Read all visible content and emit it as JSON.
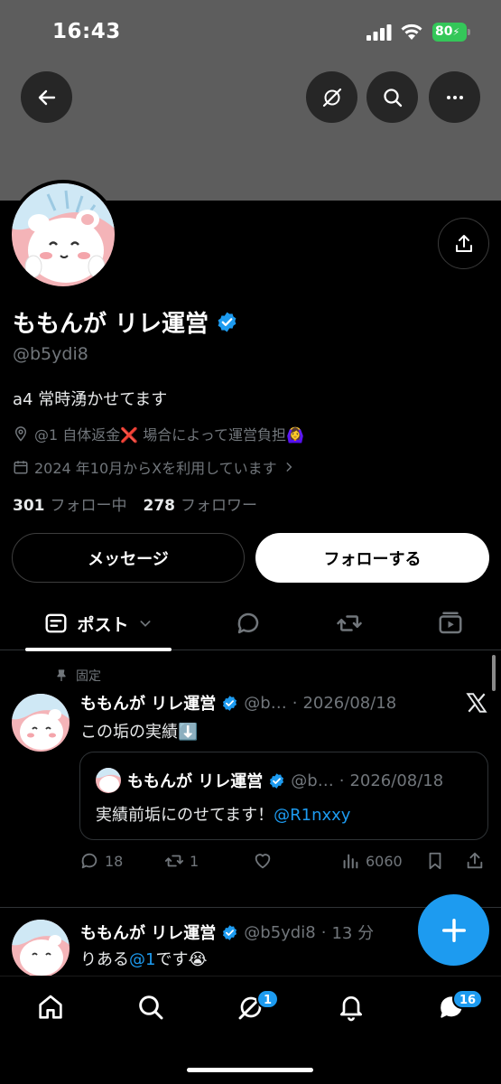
{
  "status_bar": {
    "time": "16:43",
    "battery": "80"
  },
  "profile": {
    "display_name": "ももんが リレ運営",
    "handle": "@b5ydi8",
    "bio": "a4 常時湧かせてます",
    "location": "@1 自体返金❌ 場合によって運営負担🙆‍♀️",
    "joined": "2024 年10月からXを利用しています",
    "following_count": "301",
    "following_label": "フォロー中",
    "followers_count": "278",
    "followers_label": "フォロワー",
    "message_label": "メッセージ",
    "follow_label": "フォローする"
  },
  "tabs": {
    "active_label": "ポスト"
  },
  "pinned_post": {
    "pinned_label": "固定",
    "name": "ももんが リレ運営",
    "handle_time": "@b…",
    "date": "2026/08/18",
    "text": "この垢の実績⬇️",
    "quote": {
      "name": "ももんが リレ運営",
      "handle_time": "@b…",
      "date": "2026/08/18",
      "text": "実績前垢にのせてます！",
      "link": "@R1nxxy"
    },
    "replies": "18",
    "reposts": "1",
    "views": "6060"
  },
  "second_post": {
    "name": "ももんが リレ運営",
    "handle": "@b5ydi8",
    "time": "13 分",
    "text_prefix": "りある",
    "mention": "@1",
    "text_suffix": "です😭"
  },
  "bottom_nav": {
    "grok_badge": "1",
    "messages_badge": "16"
  },
  "colors": {
    "accent": "#1d9bf0",
    "verified": "#1d9bf0",
    "banner": "#5d5d5d"
  }
}
